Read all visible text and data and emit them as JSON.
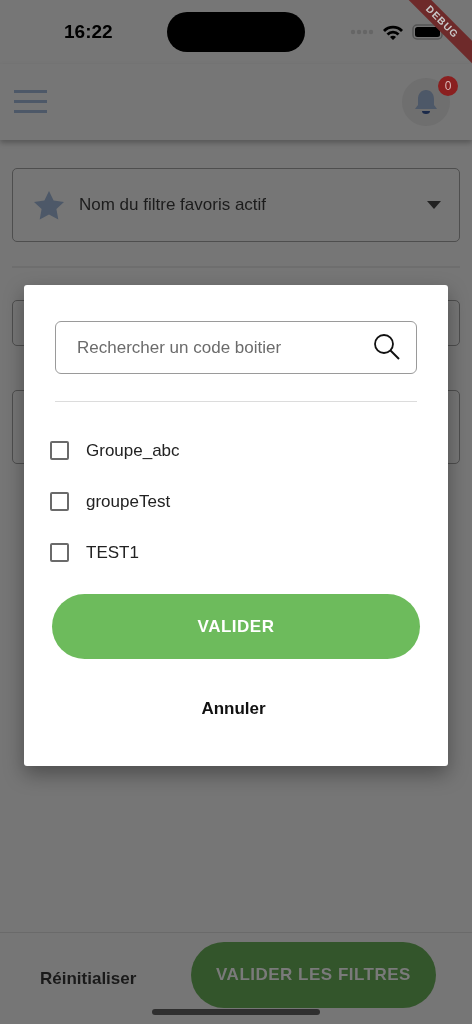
{
  "status_bar": {
    "time": "16:22"
  },
  "debug_banner": "DEBUG",
  "header": {
    "notification_count": "0"
  },
  "favorite_filter": {
    "value": "Nom du filtre favoris actif"
  },
  "dialog": {
    "search": {
      "placeholder": "Rechercher un code boitier"
    },
    "options": [
      {
        "label": "Groupe_abc",
        "checked": false
      },
      {
        "label": "groupeTest",
        "checked": false
      },
      {
        "label": "TEST1",
        "checked": false
      }
    ],
    "confirm": "VALIDER",
    "cancel": "Annuler"
  },
  "footer": {
    "reset": "Réinitialiser",
    "apply": "VALIDER LES FILTRES"
  }
}
